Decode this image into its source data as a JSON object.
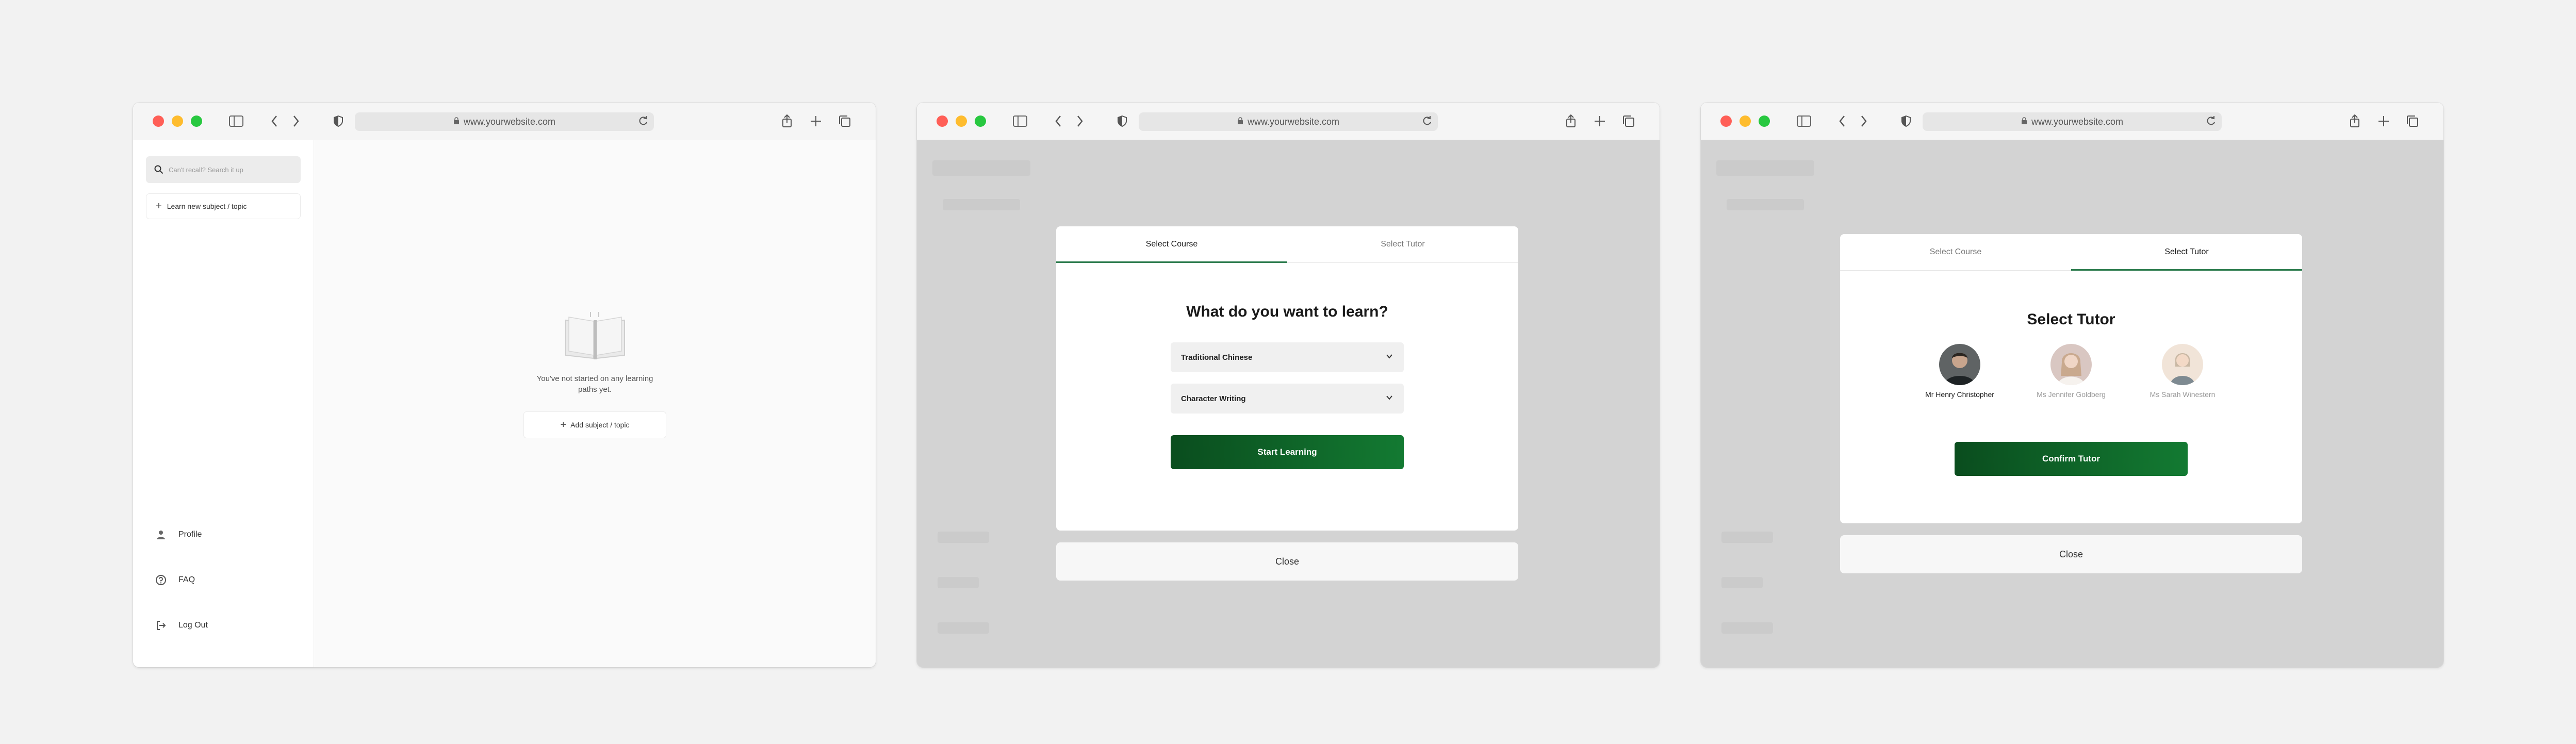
{
  "browser": {
    "url": "www.yourwebsite.com"
  },
  "screen1": {
    "search_placeholder": "Can't recall? Search it up",
    "learn_button": "Learn new subject / topic",
    "empty_message": "You've not started on any learning paths yet.",
    "add_button": "Add subject / topic",
    "nav": [
      {
        "label": "Profile",
        "icon": "person-icon"
      },
      {
        "label": "FAQ",
        "icon": "question-icon"
      },
      {
        "label": "Log Out",
        "icon": "logout-icon"
      }
    ]
  },
  "screen2": {
    "tabs": [
      "Select Course",
      "Select Tutor"
    ],
    "active_tab": 0,
    "title": "What do you want to learn?",
    "select_language": "Traditional Chinese",
    "select_topic": "Character Writing",
    "cta": "Start Learning",
    "close": "Close"
  },
  "screen3": {
    "tabs": [
      "Select Course",
      "Select Tutor"
    ],
    "active_tab": 1,
    "title": "Select Tutor",
    "tutors": [
      {
        "name": "Mr Henry Christopher",
        "selected": true
      },
      {
        "name": "Ms Jennifer Goldberg",
        "selected": false
      },
      {
        "name": "Ms Sarah Winestern",
        "selected": false
      }
    ],
    "cta": "Confirm Tutor",
    "close": "Close"
  },
  "colors": {
    "accent": "#137a32",
    "accent_dark": "#0a4d1e",
    "overlay": "#d3d3d3",
    "page_background": "#f2f2f2"
  }
}
